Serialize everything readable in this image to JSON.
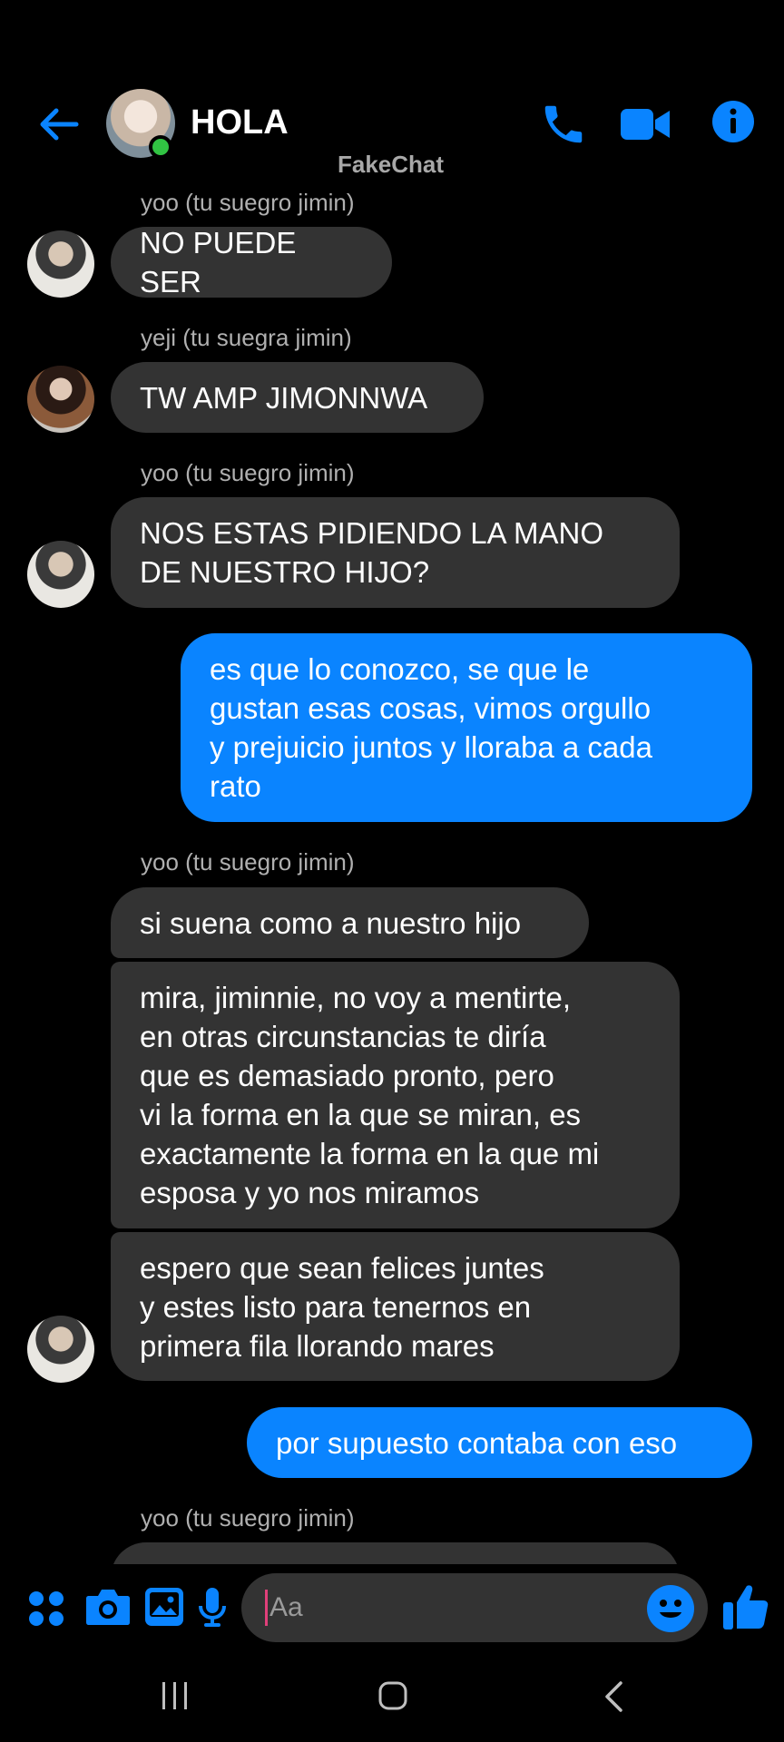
{
  "header": {
    "title": "HOLA",
    "watermark": "FakeChat"
  },
  "messages": [
    {
      "sender": "yoo (tu suegro jimin)",
      "text": "NO PUEDE SER"
    },
    {
      "sender": "yeji (tu suegra jimin)",
      "text": "TW AMP JIMONNWA"
    },
    {
      "sender": "yoo (tu suegro jimin)",
      "text": "NOS ESTAS PIDIENDO LA MANO\nDE NUESTRO HIJO?"
    },
    {
      "text": "es que lo conozco, se que le\ngustan esas cosas, vimos orgullo\ny prejuicio juntos y lloraba a cada\nrato"
    },
    {
      "sender": "yoo (tu suegro jimin)",
      "text": "si suena como a nuestro hijo"
    },
    {
      "text": "mira, jiminnie, no voy a mentirte,\nen otras circunstancias te diría\nque es demasiado pronto, pero\nvi la forma en la que se miran, es\nexactamente la forma en la que mi\nesposa y yo nos miramos"
    },
    {
      "text": "espero que sean felices juntes\ny estes listo para tenernos en\nprimera fila llorando mares"
    },
    {
      "text": "por supuesto contaba con eso"
    },
    {
      "sender": "yoo (tu suegro jimin)"
    }
  ],
  "composer": {
    "placeholder": "Aa"
  },
  "colors": {
    "accent": "#0a84ff",
    "incoming_bubble": "#333333",
    "online": "#31c443",
    "background": "#000000"
  },
  "icons": [
    "back-arrow-icon",
    "phone-icon",
    "video-camera-icon",
    "info-icon",
    "apps-icon",
    "camera-icon",
    "gallery-icon",
    "microphone-icon",
    "emoji-icon",
    "thumbs-up-icon"
  ]
}
